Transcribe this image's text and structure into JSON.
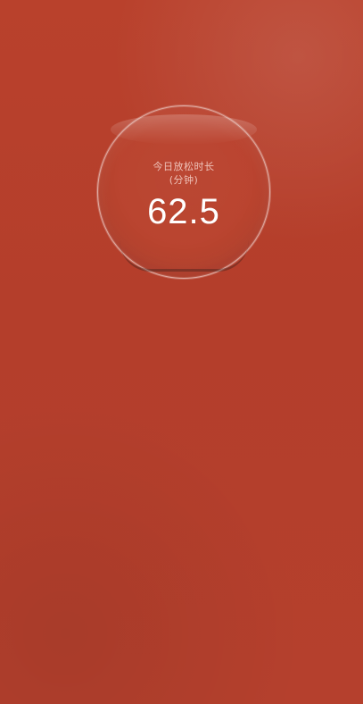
{
  "screen": {
    "background_color": "#b8402b"
  },
  "relax_card": {
    "title": "今日放松时长",
    "unit": "(分钟)",
    "value": "62.5"
  }
}
